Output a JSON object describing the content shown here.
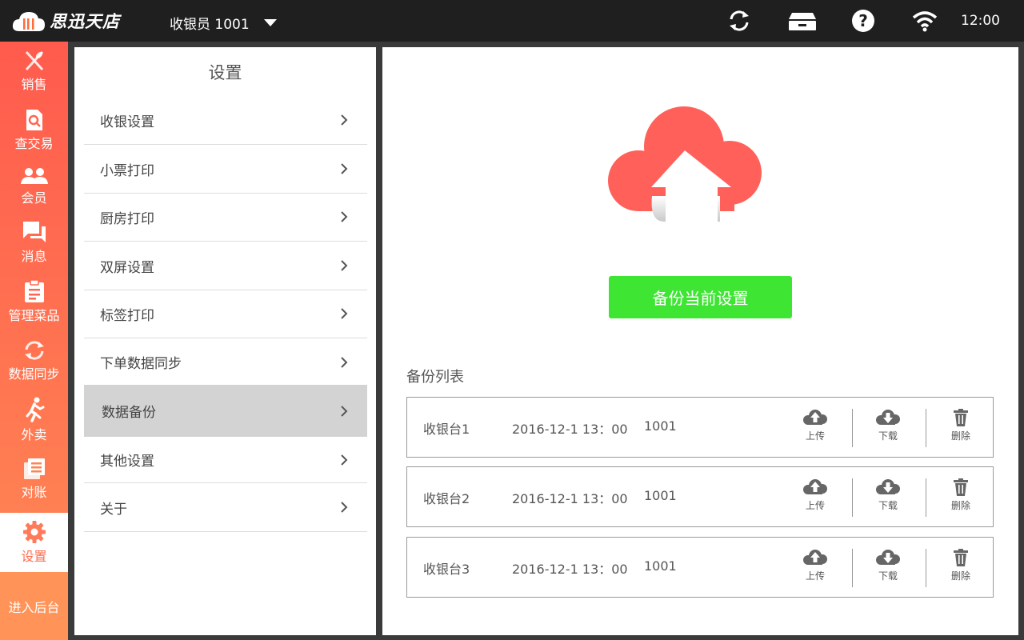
{
  "topbar": {
    "logo_text": "思迅天店",
    "cashier_label": "收银员 1001",
    "clock": "12:00"
  },
  "sidebar": {
    "items": [
      {
        "label": "销售",
        "icon": "utensils-icon"
      },
      {
        "label": "查交易",
        "icon": "document-search-icon"
      },
      {
        "label": "会员",
        "icon": "members-icon"
      },
      {
        "label": "消息",
        "icon": "chat-icon"
      },
      {
        "label": "管理菜品",
        "icon": "clipboard-icon"
      },
      {
        "label": "数据同步",
        "icon": "sync-icon"
      },
      {
        "label": "外卖",
        "icon": "runner-icon"
      },
      {
        "label": "对账",
        "icon": "ledger-icon"
      },
      {
        "label": "设置",
        "icon": "gear-icon",
        "active": true
      }
    ],
    "backend_label": "进入后台"
  },
  "menu": {
    "title": "设置",
    "items": [
      {
        "label": "收银设置"
      },
      {
        "label": "小票打印"
      },
      {
        "label": "厨房打印"
      },
      {
        "label": "双屏设置"
      },
      {
        "label": "标签打印"
      },
      {
        "label": "下单数据同步"
      },
      {
        "label": "数据备份",
        "active": true
      },
      {
        "label": "其他设置"
      },
      {
        "label": "关于"
      }
    ]
  },
  "content": {
    "backup_button": "备份当前设置",
    "list_title": "备份列表",
    "rows": [
      {
        "name": "收银台1",
        "date": "2016-12-1 13：00",
        "user": "1001"
      },
      {
        "name": "收银台2",
        "date": "2016-12-1 13：00",
        "user": "1001"
      },
      {
        "name": "收银台3",
        "date": "2016-12-1 13：00",
        "user": "1001"
      }
    ],
    "actions": {
      "upload": "上传",
      "download": "下载",
      "delete": "删除"
    }
  },
  "colors": {
    "topbar_bg": "#1f1f1f",
    "sidebar_top": "#ff5b4e",
    "sidebar_bottom": "#ff8d58",
    "backup_button": "#3ee533",
    "cloud": "#ff605a"
  }
}
